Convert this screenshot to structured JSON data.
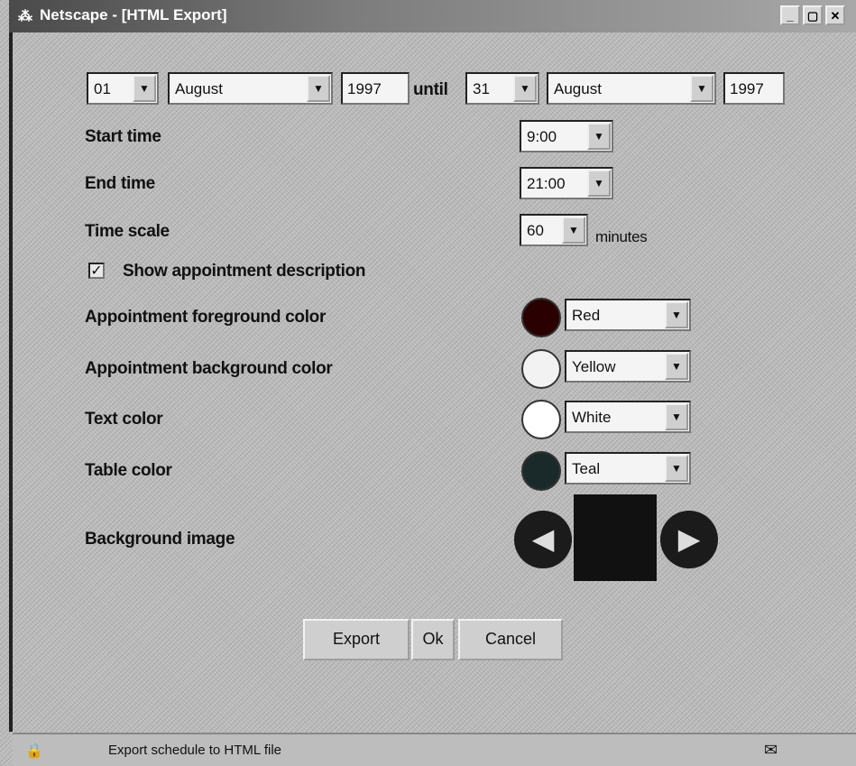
{
  "window": {
    "title": "Netscape - [HTML Export]",
    "app_icon": "netscape-icon",
    "minimize": "_",
    "maximize": "▢",
    "close": "✕"
  },
  "date_range": {
    "start_day": "01",
    "start_month": "August",
    "start_year": "1997",
    "until_label": "until",
    "end_day": "31",
    "end_month": "August",
    "end_year": "1997"
  },
  "start_time": {
    "label": "Start time",
    "value": "9:00"
  },
  "end_time": {
    "label": "End time",
    "value": "21:00"
  },
  "time_scale": {
    "label": "Time scale",
    "value": "60",
    "unit": "minutes"
  },
  "show_description": {
    "label": "Show appointment description",
    "checked": true,
    "mark": "✓"
  },
  "colors": {
    "foreground": {
      "label": "Appointment foreground color",
      "value": "Red",
      "swatch": "#2a0000"
    },
    "background": {
      "label": "Appointment background color",
      "value": "Yellow",
      "swatch": "#f2f2f2"
    },
    "text": {
      "label": "Text color",
      "value": "White",
      "swatch": "#ffffff"
    },
    "table": {
      "label": "Table color",
      "value": "Teal",
      "swatch": "#1a2a2a"
    }
  },
  "background_image": {
    "label": "Background image",
    "prev": "◀",
    "next": "▶"
  },
  "buttons": {
    "export": "Export",
    "ok": "Ok",
    "cancel": "Cancel"
  },
  "status": {
    "message": "Export schedule to HTML file",
    "icon": "security-icon",
    "mail_icon": "mail-icon"
  }
}
